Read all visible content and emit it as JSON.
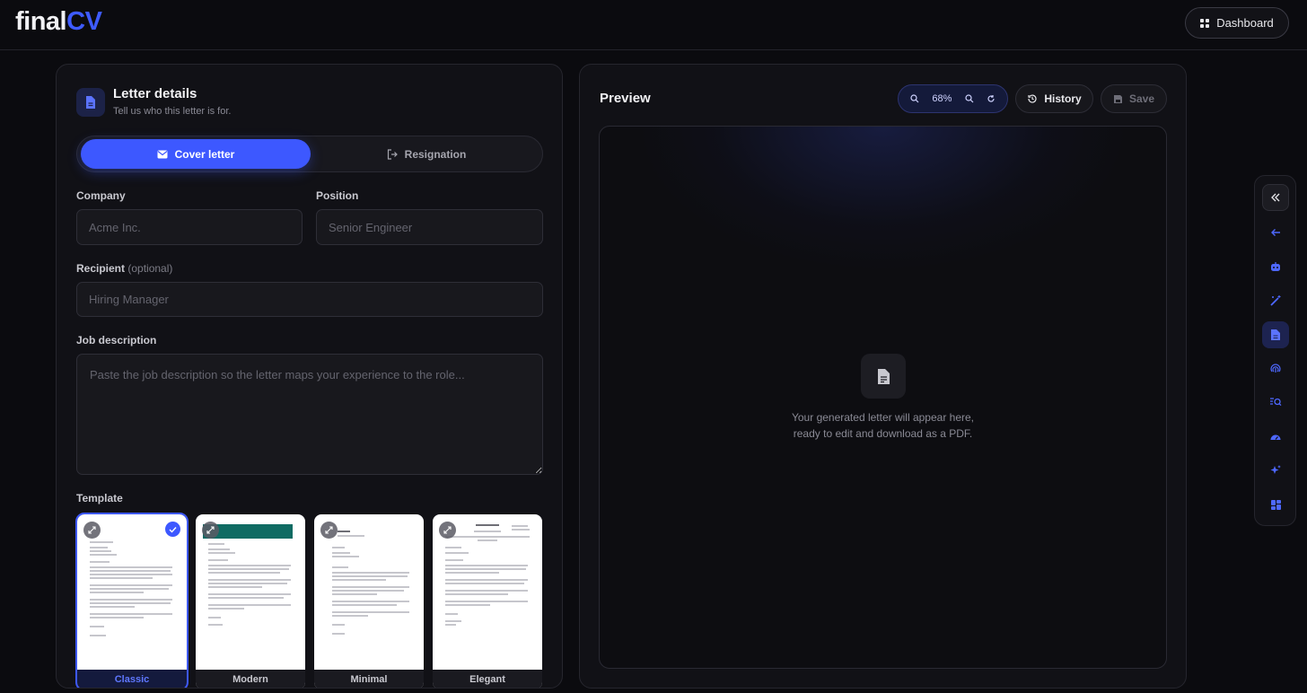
{
  "header": {
    "logo_main": "final",
    "logo_accent": "CV",
    "dashboard_label": "Dashboard"
  },
  "letter": {
    "title": "Letter details",
    "subtitle": "Tell us who this letter is for.",
    "types": [
      {
        "label": "Cover letter",
        "selected": true
      },
      {
        "label": "Resignation",
        "selected": false
      }
    ],
    "company": {
      "label": "Company",
      "placeholder": "Acme Inc.",
      "value": ""
    },
    "position": {
      "label": "Position",
      "placeholder": "Senior Engineer",
      "value": ""
    },
    "recipient": {
      "label": "Recipient",
      "optional": "(optional)",
      "placeholder": "Hiring Manager",
      "value": ""
    },
    "job_description": {
      "label": "Job description",
      "placeholder": "Paste the job description so the letter maps your experience to the role...",
      "value": ""
    },
    "template_label": "Template",
    "templates": [
      {
        "name": "Classic",
        "selected": true
      },
      {
        "name": "Modern",
        "selected": false
      },
      {
        "name": "Minimal",
        "selected": false
      },
      {
        "name": "Elegant",
        "selected": false
      }
    ]
  },
  "preview": {
    "title": "Preview",
    "zoom": "68%",
    "history_label": "History",
    "save_label": "Save",
    "empty_line1": "Your generated letter will appear here,",
    "empty_line2": "ready to edit and download as a PDF."
  },
  "rail": {
    "items": [
      "collapse-icon",
      "back-arrow-icon",
      "robot-icon",
      "magic-wand-icon",
      "document-icon",
      "fingerprint-icon",
      "search-list-icon",
      "gauge-icon",
      "sparkles-icon",
      "dashboard-grid-icon"
    ],
    "active": "document-icon"
  },
  "colors": {
    "accent": "#3d58ff",
    "background": "#0b0b0f",
    "panel": "#111116"
  }
}
